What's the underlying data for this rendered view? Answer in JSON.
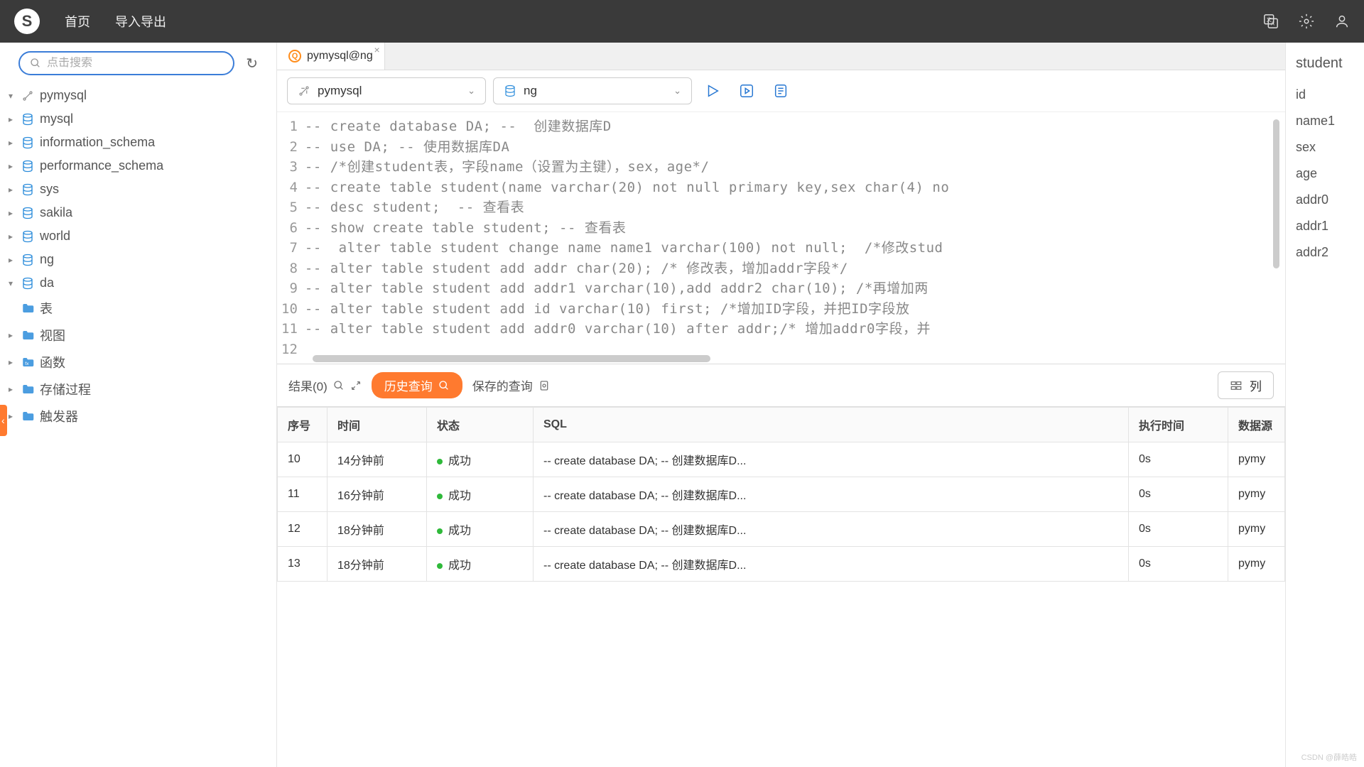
{
  "topbar": {
    "logo": "S",
    "home": "首页",
    "impexp": "导入导出"
  },
  "sidebar": {
    "search_placeholder": "点击搜索",
    "connection": "pymysql",
    "dbs": [
      "mysql",
      "information_schema",
      "performance_schema",
      "sys",
      "sakila",
      "world",
      "ng",
      "da"
    ],
    "da_children": {
      "table": "表",
      "view": "视图",
      "func": "函数",
      "proc": "存储过程",
      "trigger": "触发器"
    }
  },
  "tabs": {
    "active": "pymysql@ng"
  },
  "toolbar": {
    "conn": "pymysql",
    "db": "ng"
  },
  "editor": {
    "lines": [
      "-- create database DA; --  创建数据库D",
      "-- use DA; -- 使用数据库DA",
      "-- /*创建student表，字段name（设置为主键），sex，age*/",
      "-- create table student(name varchar(20) not null primary key,sex char(4) no",
      "-- desc student;  -- 查看表",
      "-- show create table student; -- 查看表",
      "--  alter table student change name name1 varchar(100) not null;  /*修改stud",
      "-- alter table student add addr char(20); /* 修改表，增加addr字段*/",
      "-- alter table student add addr1 varchar(10),add addr2 char(10); /*再增加两",
      "-- alter table student add id varchar(10) first; /*增加ID字段，并把ID字段放",
      "-- alter table student add addr0 varchar(10) after addr;/* 增加addr0字段，并",
      ""
    ]
  },
  "results_bar": {
    "results": "结果(0)",
    "history": "历史查询",
    "saved": "保存的查询",
    "cols": "列"
  },
  "history_table": {
    "headers": {
      "seq": "序号",
      "time": "时间",
      "status": "状态",
      "sql": "SQL",
      "dur": "执行时间",
      "src": "数据源"
    },
    "rows": [
      {
        "seq": "10",
        "time": "14分钟前",
        "status": "成功",
        "sql": "-- create database DA; -- 创建数据库D...",
        "dur": "0s",
        "src": "pymy"
      },
      {
        "seq": "11",
        "time": "16分钟前",
        "status": "成功",
        "sql": "-- create database DA; -- 创建数据库D...",
        "dur": "0s",
        "src": "pymy"
      },
      {
        "seq": "12",
        "time": "18分钟前",
        "status": "成功",
        "sql": "-- create database DA; -- 创建数据库D...",
        "dur": "0s",
        "src": "pymy"
      },
      {
        "seq": "13",
        "time": "18分钟前",
        "status": "成功",
        "sql": "-- create database DA; -- 创建数据库D...",
        "dur": "0s",
        "src": "pymy"
      }
    ]
  },
  "right_panel": {
    "title": "student",
    "cols": [
      "id",
      "name1",
      "sex",
      "age",
      "addr0",
      "addr1",
      "addr2"
    ]
  },
  "watermark": "CSDN @薛皓皓"
}
